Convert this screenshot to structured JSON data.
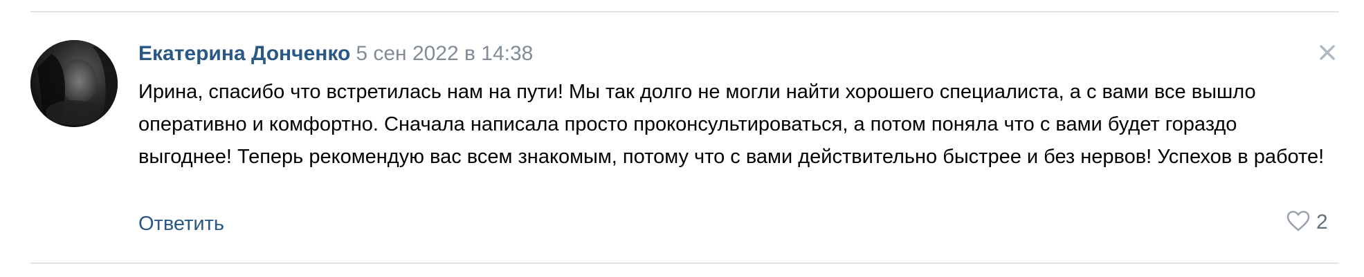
{
  "comment": {
    "author": "Екатерина Донченко",
    "date": "5 сен 2022 в 14:38",
    "text": "Ирина, спасибо что встретилась нам на пути! Мы так долго не могли найти хорошего специалиста, а с вами все вышло оперативно и комфортно. Сначала написала просто проконсультироваться, а потом поняла что с вами будет гораздо выгоднее! Теперь рекомендую вас всем знакомым, потому что с вами действительно быстрее и без нервов! Успехов в работе!",
    "reply_label": "Ответить",
    "likes": "2",
    "close_icon": "close-icon",
    "like_icon": "heart-outline-icon"
  },
  "colors": {
    "author": "#2a5885",
    "date": "#818c99",
    "divider": "#e1e3e6",
    "icon": "#99a2ad"
  }
}
